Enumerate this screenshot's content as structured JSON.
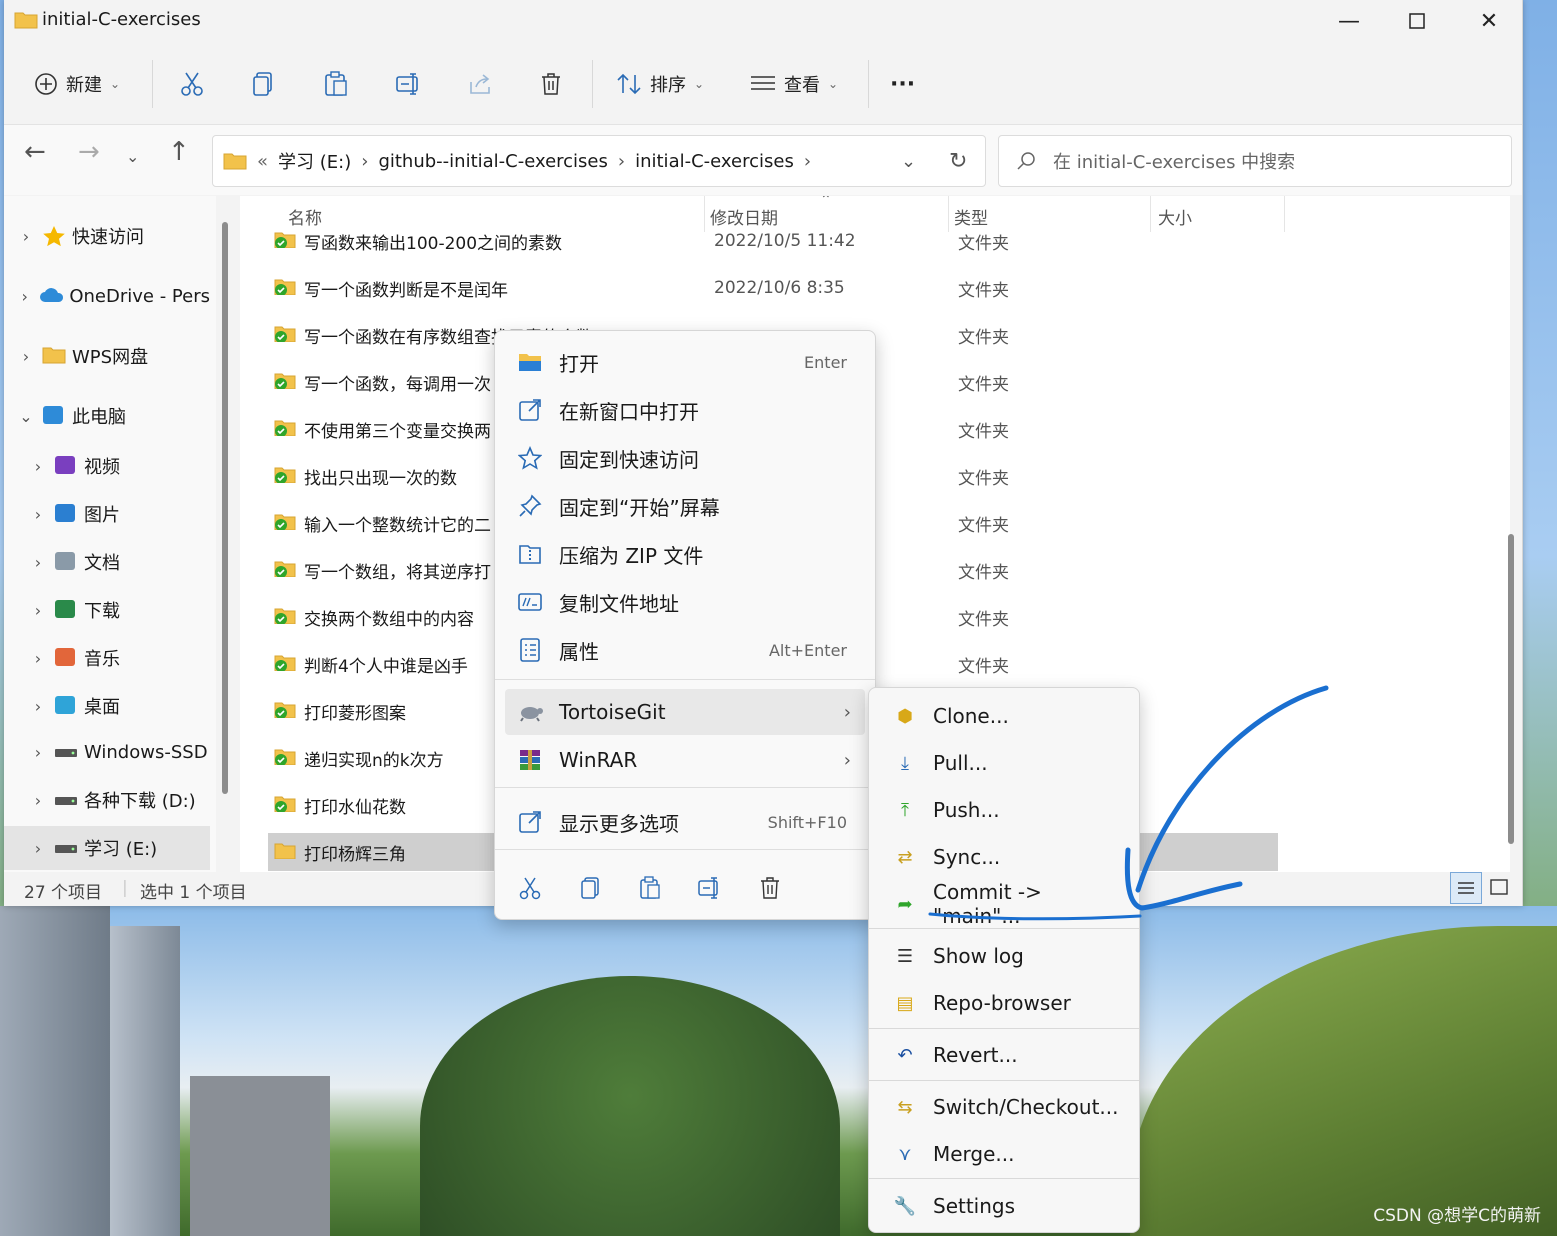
{
  "window": {
    "title": "initial-C-exercises"
  },
  "toolbar": {
    "new_label": "新建",
    "sort_label": "排序",
    "view_label": "查看",
    "more_label": "···"
  },
  "address": {
    "overflow": "«",
    "crumbs": [
      "学习 (E:)",
      "github--initial-C-exercises",
      "initial-C-exercises"
    ],
    "search_placeholder": "在 initial-C-exercises 中搜索"
  },
  "sidebar": {
    "items": [
      {
        "label": "快速访问",
        "icon": "star-icon"
      },
      {
        "label": "OneDrive - Pers",
        "icon": "cloud-icon"
      },
      {
        "label": "WPS网盘",
        "icon": "folder-icon"
      },
      {
        "label": "此电脑",
        "icon": "computer-icon"
      },
      {
        "label": "视频",
        "icon": "video-icon"
      },
      {
        "label": "图片",
        "icon": "picture-icon"
      },
      {
        "label": "文档",
        "icon": "document-icon"
      },
      {
        "label": "下载",
        "icon": "download-icon"
      },
      {
        "label": "音乐",
        "icon": "music-icon"
      },
      {
        "label": "桌面",
        "icon": "desktop-icon"
      },
      {
        "label": "Windows-SSD",
        "icon": "drive-icon"
      },
      {
        "label": "各种下载 (D:)",
        "icon": "drive-icon"
      },
      {
        "label": "学习 (E:)",
        "icon": "drive-icon"
      }
    ]
  },
  "columns": {
    "name": "名称",
    "date": "修改日期",
    "type": "类型",
    "size": "大小"
  },
  "files": [
    {
      "name": "写函数来输出100-200之间的素数",
      "date": "2022/10/5 11:42",
      "type": "文件夹"
    },
    {
      "name": "写一个函数判断是不是闰年",
      "date": "2022/10/6 8:35",
      "type": "文件夹"
    },
    {
      "name": "写一个函数在有序数组查找元素的个数",
      "date": "",
      "type": "文件夹"
    },
    {
      "name": "写一个函数，每调用一次",
      "date": "",
      "type": "文件夹"
    },
    {
      "name": "不使用第三个变量交换两",
      "date": "",
      "type": "文件夹"
    },
    {
      "name": "找出只出现一次的数",
      "date": "",
      "type": "文件夹"
    },
    {
      "name": "输入一个整数统计它的二",
      "date": "",
      "type": "文件夹"
    },
    {
      "name": "写一个数组，将其逆序打",
      "date": "",
      "type": "文件夹"
    },
    {
      "name": "交换两个数组中的内容",
      "date": "",
      "type": "文件夹"
    },
    {
      "name": "判断4个人中谁是凶手",
      "date": "",
      "type": "文件夹"
    },
    {
      "name": "打印菱形图案",
      "date": "",
      "type": ""
    },
    {
      "name": "递归实现n的k次方",
      "date": "",
      "type": ""
    },
    {
      "name": "打印水仙花数",
      "date": "",
      "type": ""
    },
    {
      "name": "打印杨辉三角",
      "date": "",
      "type": ""
    }
  ],
  "status": {
    "count": "27 个项目",
    "selected": "选中 1 个项目"
  },
  "context_menu": {
    "items": [
      {
        "label": "打开",
        "shortcut": "Enter"
      },
      {
        "label": "在新窗口中打开",
        "shortcut": ""
      },
      {
        "label": "固定到快速访问",
        "shortcut": ""
      },
      {
        "label": "固定到“开始”屏幕",
        "shortcut": ""
      },
      {
        "label": "压缩为 ZIP 文件",
        "shortcut": ""
      },
      {
        "label": "复制文件地址",
        "shortcut": ""
      },
      {
        "label": "属性",
        "shortcut": "Alt+Enter"
      },
      {
        "label": "TortoiseGit",
        "shortcut": ""
      },
      {
        "label": "WinRAR",
        "shortcut": ""
      },
      {
        "label": "显示更多选项",
        "shortcut": "Shift+F10"
      }
    ]
  },
  "submenu": {
    "items": [
      {
        "label": "Clone..."
      },
      {
        "label": "Pull..."
      },
      {
        "label": "Push..."
      },
      {
        "label": "Sync..."
      },
      {
        "label": "Commit -> \"main\"..."
      },
      {
        "label": "Show log"
      },
      {
        "label": "Repo-browser"
      },
      {
        "label": "Revert..."
      },
      {
        "label": "Switch/Checkout..."
      },
      {
        "label": "Merge..."
      },
      {
        "label": "Settings"
      }
    ]
  },
  "watermark": "CSDN @想学C的萌新",
  "colors": {
    "accent": "#0067c0",
    "folder": "#f2c24b",
    "annotation": "#1a6fd0",
    "git_green": "#2fa52b"
  }
}
